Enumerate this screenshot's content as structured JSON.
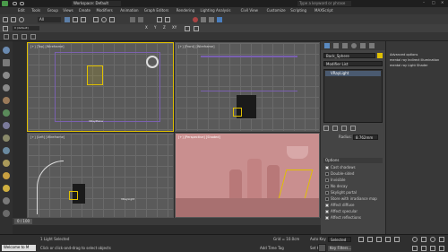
{
  "title": {
    "workspace": "Workspace: Default",
    "search_placeholder": "Type a keyword or phrase"
  },
  "menu": [
    "Edit",
    "Tools",
    "Group",
    "Views",
    "Create",
    "Modifiers",
    "Animation",
    "Graph Editors",
    "Rendering",
    "Lighting Analysis",
    "Civil View",
    "Customize",
    "Scripting",
    "MAXScript"
  ],
  "toolbar": {
    "selection_filter": "All",
    "axes": [
      "X",
      "Y",
      "Z",
      "XY"
    ],
    "layer": "0 (default)"
  },
  "viewports": {
    "top": "[+] [Top] [Wireframe]",
    "front": "[+] [Front] [Wireframe]",
    "left": "[+] [Left] [Wireframe]",
    "perspective": "[+] [Perspective] [Shaded]",
    "left_tag": "VRayLight",
    "top_tag": "VRayPlane"
  },
  "command_panel": {
    "object_name": "Back_Sphere",
    "modifier_list": "Modifier List",
    "stack_item": "VRayLight",
    "radius_label": "Radius:",
    "radius_value": "8.762mm",
    "options_header": "Options",
    "options": [
      {
        "label": "Cast shadows",
        "checked": true
      },
      {
        "label": "Double-sided",
        "checked": false
      },
      {
        "label": "Invisible",
        "checked": false
      },
      {
        "label": "No decay",
        "checked": false
      },
      {
        "label": "Skylight portal",
        "checked": false
      },
      {
        "label": "Store with irradiance map",
        "checked": false
      },
      {
        "label": "Affect diffuse",
        "checked": true
      },
      {
        "label": "Affect specular",
        "checked": true
      },
      {
        "label": "Affect reflections",
        "checked": true
      }
    ]
  },
  "scene_explorer": {
    "items": [
      "Advanced options",
      "mental ray Indirect Illumination",
      "mental ray Light Shader"
    ]
  },
  "timeline": {
    "frame": "0 / 100"
  },
  "status": {
    "welcome": "Welcome to M",
    "selected": "1 Light Selected",
    "hint": "Click or click-and-drag to select objects",
    "grid": "Grid = 10.0cm",
    "auto_key": "Auto Key",
    "set_key": "Set Key",
    "selected_dropdown": "Selected",
    "key_filters": "Key Filters...",
    "add_time_tag": "Add Time Tag"
  },
  "colors": {
    "accent_yellow": "#e0c000",
    "perspective_bg": "#c98f8f",
    "title_blue": "#4a7fc0"
  }
}
